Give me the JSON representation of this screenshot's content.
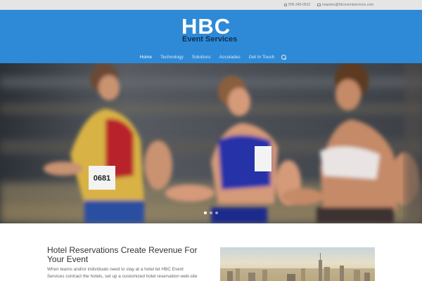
{
  "topbar": {
    "phone": "505-346-0522",
    "email": "inquiries@hbceventservices.com"
  },
  "logo": {
    "main": "HBC",
    "sub": "Event Services"
  },
  "nav": {
    "items": [
      "Home",
      "Technology",
      "Solutions",
      "Accolades",
      "Get In Touch"
    ],
    "active": "Home"
  },
  "slider": {
    "dots": 3,
    "active_dot": 0
  },
  "runner_bibs": [
    "0681",
    "",
    ""
  ],
  "content": {
    "title": "Hotel Reservations Create Revenue For Your Event",
    "text": "When teams and/or individuals need to stay at a hotel let HBC Event Services contract the hotels, set up a customized hotel reservation web-site for your"
  },
  "colors": {
    "header_bg": "#2e8ad6",
    "topbar_bg": "#e5e5e5",
    "logo_sub": "#0d2f56"
  }
}
